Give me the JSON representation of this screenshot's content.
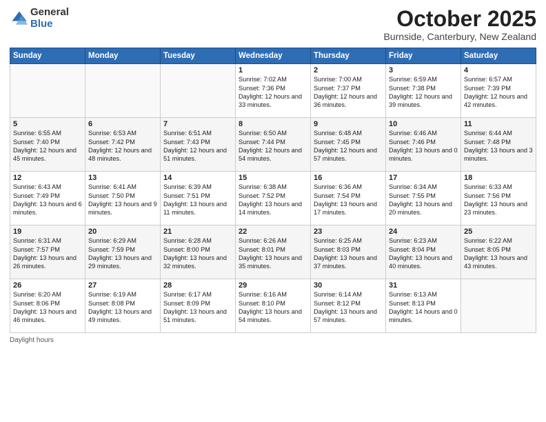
{
  "header": {
    "logo_general": "General",
    "logo_blue": "Blue",
    "month_title": "October 2025",
    "subtitle": "Burnside, Canterbury, New Zealand"
  },
  "days_of_week": [
    "Sunday",
    "Monday",
    "Tuesday",
    "Wednesday",
    "Thursday",
    "Friday",
    "Saturday"
  ],
  "footer_text": "Daylight hours",
  "weeks": [
    [
      {
        "day": "",
        "content": ""
      },
      {
        "day": "",
        "content": ""
      },
      {
        "day": "",
        "content": ""
      },
      {
        "day": "1",
        "content": "Sunrise: 7:02 AM\nSunset: 7:36 PM\nDaylight: 12 hours\nand 33 minutes."
      },
      {
        "day": "2",
        "content": "Sunrise: 7:00 AM\nSunset: 7:37 PM\nDaylight: 12 hours\nand 36 minutes."
      },
      {
        "day": "3",
        "content": "Sunrise: 6:59 AM\nSunset: 7:38 PM\nDaylight: 12 hours\nand 39 minutes."
      },
      {
        "day": "4",
        "content": "Sunrise: 6:57 AM\nSunset: 7:39 PM\nDaylight: 12 hours\nand 42 minutes."
      }
    ],
    [
      {
        "day": "5",
        "content": "Sunrise: 6:55 AM\nSunset: 7:40 PM\nDaylight: 12 hours\nand 45 minutes."
      },
      {
        "day": "6",
        "content": "Sunrise: 6:53 AM\nSunset: 7:42 PM\nDaylight: 12 hours\nand 48 minutes."
      },
      {
        "day": "7",
        "content": "Sunrise: 6:51 AM\nSunset: 7:43 PM\nDaylight: 12 hours\nand 51 minutes."
      },
      {
        "day": "8",
        "content": "Sunrise: 6:50 AM\nSunset: 7:44 PM\nDaylight: 12 hours\nand 54 minutes."
      },
      {
        "day": "9",
        "content": "Sunrise: 6:48 AM\nSunset: 7:45 PM\nDaylight: 12 hours\nand 57 minutes."
      },
      {
        "day": "10",
        "content": "Sunrise: 6:46 AM\nSunset: 7:46 PM\nDaylight: 13 hours\nand 0 minutes."
      },
      {
        "day": "11",
        "content": "Sunrise: 6:44 AM\nSunset: 7:48 PM\nDaylight: 13 hours\nand 3 minutes."
      }
    ],
    [
      {
        "day": "12",
        "content": "Sunrise: 6:43 AM\nSunset: 7:49 PM\nDaylight: 13 hours\nand 6 minutes."
      },
      {
        "day": "13",
        "content": "Sunrise: 6:41 AM\nSunset: 7:50 PM\nDaylight: 13 hours\nand 9 minutes."
      },
      {
        "day": "14",
        "content": "Sunrise: 6:39 AM\nSunset: 7:51 PM\nDaylight: 13 hours\nand 11 minutes."
      },
      {
        "day": "15",
        "content": "Sunrise: 6:38 AM\nSunset: 7:52 PM\nDaylight: 13 hours\nand 14 minutes."
      },
      {
        "day": "16",
        "content": "Sunrise: 6:36 AM\nSunset: 7:54 PM\nDaylight: 13 hours\nand 17 minutes."
      },
      {
        "day": "17",
        "content": "Sunrise: 6:34 AM\nSunset: 7:55 PM\nDaylight: 13 hours\nand 20 minutes."
      },
      {
        "day": "18",
        "content": "Sunrise: 6:33 AM\nSunset: 7:56 PM\nDaylight: 13 hours\nand 23 minutes."
      }
    ],
    [
      {
        "day": "19",
        "content": "Sunrise: 6:31 AM\nSunset: 7:57 PM\nDaylight: 13 hours\nand 26 minutes."
      },
      {
        "day": "20",
        "content": "Sunrise: 6:29 AM\nSunset: 7:59 PM\nDaylight: 13 hours\nand 29 minutes."
      },
      {
        "day": "21",
        "content": "Sunrise: 6:28 AM\nSunset: 8:00 PM\nDaylight: 13 hours\nand 32 minutes."
      },
      {
        "day": "22",
        "content": "Sunrise: 6:26 AM\nSunset: 8:01 PM\nDaylight: 13 hours\nand 35 minutes."
      },
      {
        "day": "23",
        "content": "Sunrise: 6:25 AM\nSunset: 8:03 PM\nDaylight: 13 hours\nand 37 minutes."
      },
      {
        "day": "24",
        "content": "Sunrise: 6:23 AM\nSunset: 8:04 PM\nDaylight: 13 hours\nand 40 minutes."
      },
      {
        "day": "25",
        "content": "Sunrise: 6:22 AM\nSunset: 8:05 PM\nDaylight: 13 hours\nand 43 minutes."
      }
    ],
    [
      {
        "day": "26",
        "content": "Sunrise: 6:20 AM\nSunset: 8:06 PM\nDaylight: 13 hours\nand 46 minutes."
      },
      {
        "day": "27",
        "content": "Sunrise: 6:19 AM\nSunset: 8:08 PM\nDaylight: 13 hours\nand 49 minutes."
      },
      {
        "day": "28",
        "content": "Sunrise: 6:17 AM\nSunset: 8:09 PM\nDaylight: 13 hours\nand 51 minutes."
      },
      {
        "day": "29",
        "content": "Sunrise: 6:16 AM\nSunset: 8:10 PM\nDaylight: 13 hours\nand 54 minutes."
      },
      {
        "day": "30",
        "content": "Sunrise: 6:14 AM\nSunset: 8:12 PM\nDaylight: 13 hours\nand 57 minutes."
      },
      {
        "day": "31",
        "content": "Sunrise: 6:13 AM\nSunset: 8:13 PM\nDaylight: 14 hours\nand 0 minutes."
      },
      {
        "day": "",
        "content": ""
      }
    ]
  ]
}
